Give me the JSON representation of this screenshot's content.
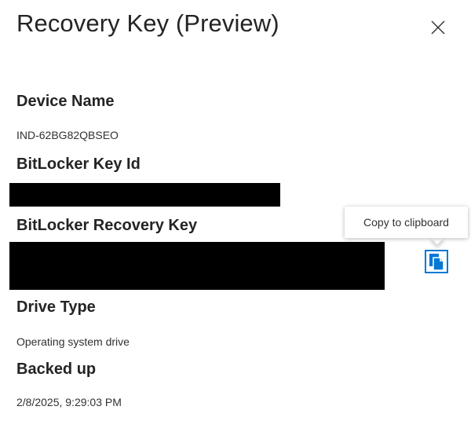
{
  "panel": {
    "title": "Recovery Key (Preview)"
  },
  "fields": {
    "device_name": {
      "label": "Device Name",
      "value": "IND-62BG82QBSEO"
    },
    "key_id": {
      "label": "BitLocker Key Id"
    },
    "recovery_key": {
      "label": "BitLocker Recovery Key"
    },
    "drive_type": {
      "label": "Drive Type",
      "value": "Operating system drive"
    },
    "backed_up": {
      "label": "Backed up",
      "value": "2/8/2025, 9:29:03 PM"
    }
  },
  "tooltip": {
    "text": "Copy to clipboard"
  },
  "icons": {
    "close": "close-icon",
    "copy": "copy-icon"
  },
  "colors": {
    "text": "#242424",
    "accent": "#0078d4",
    "redaction": "#000000"
  }
}
